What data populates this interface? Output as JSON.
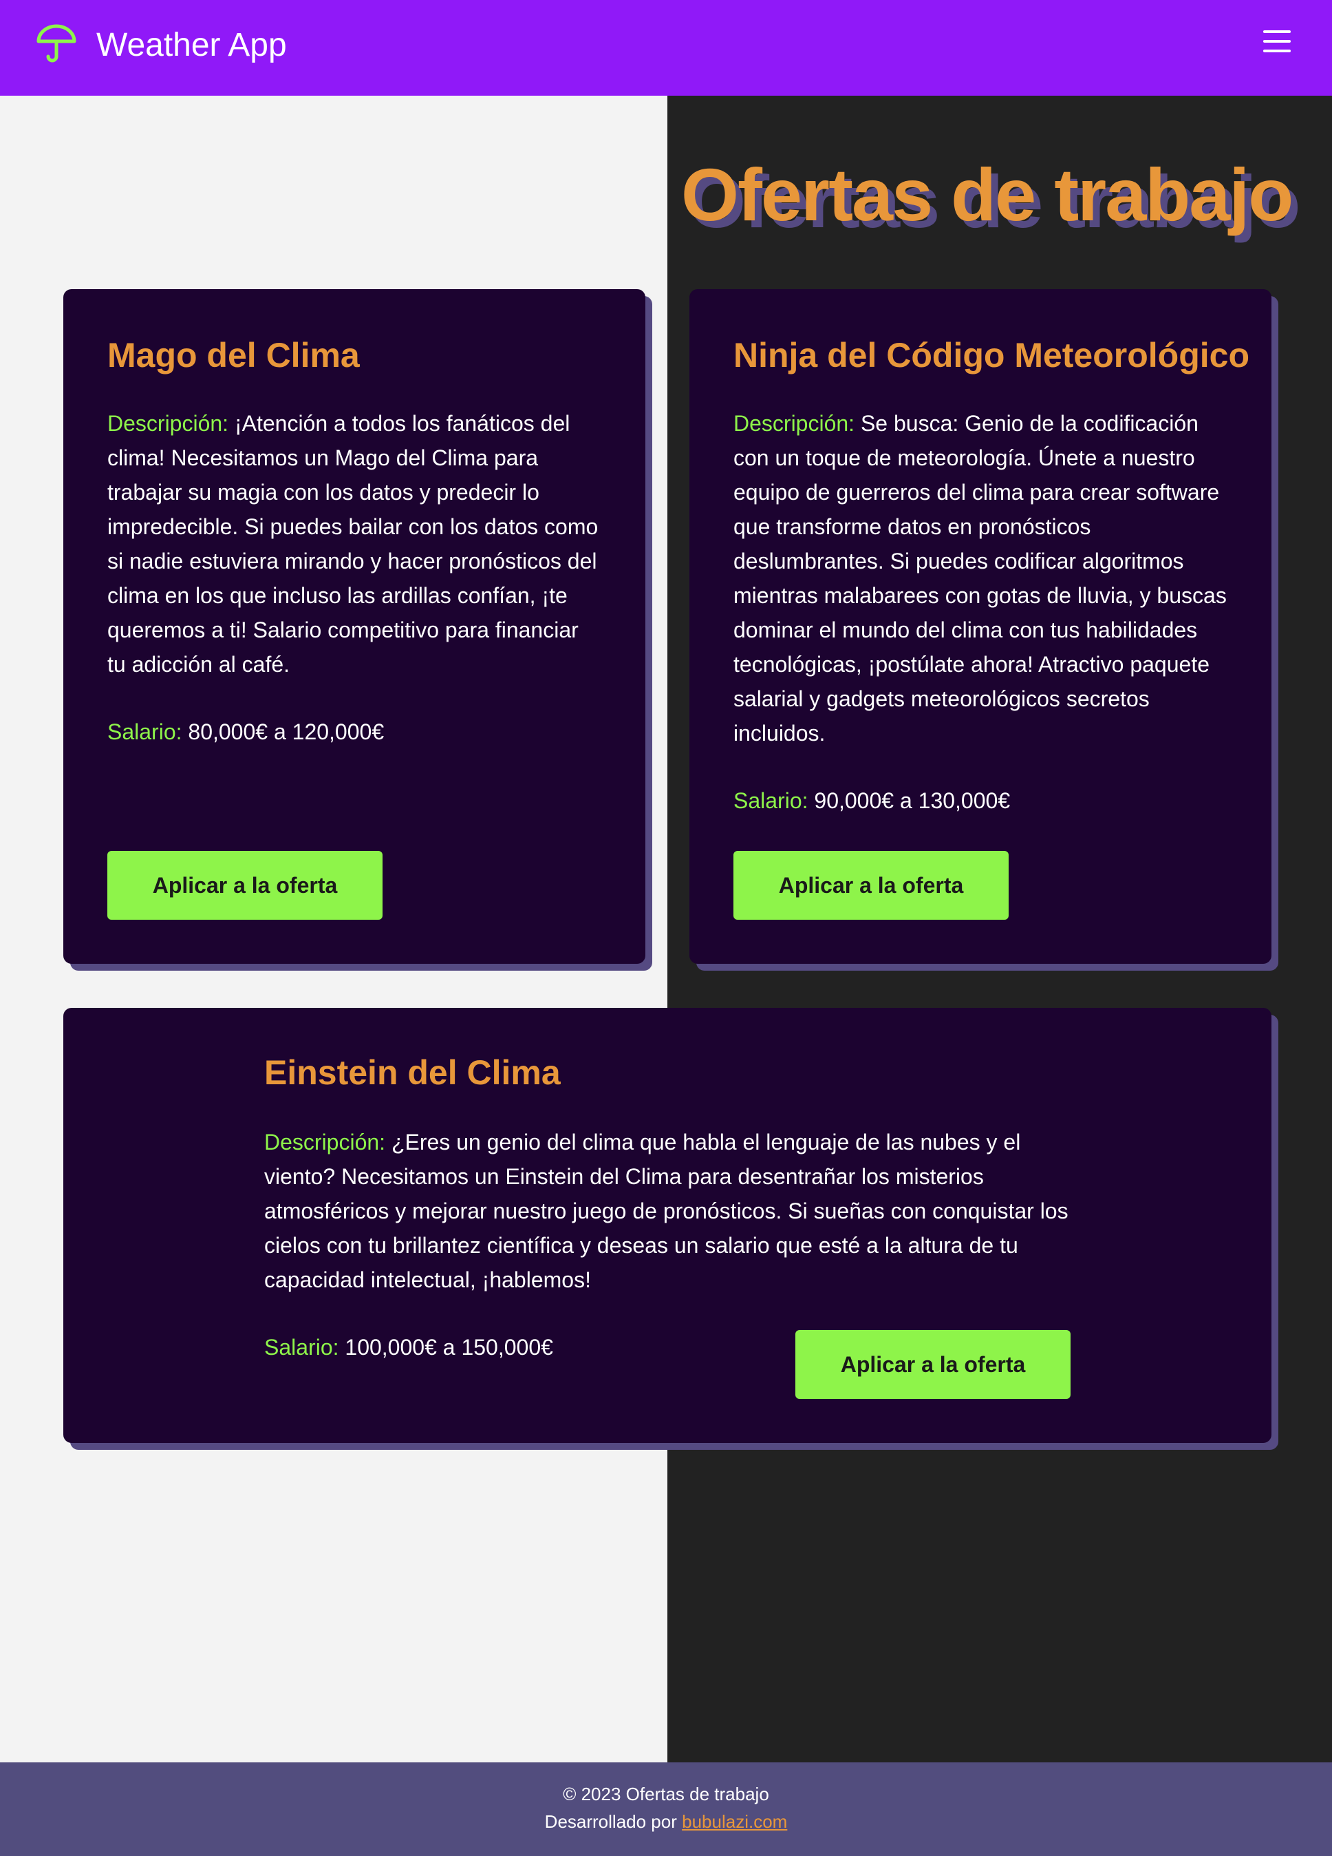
{
  "header": {
    "app_title": "Weather App",
    "logo_icon": "umbrella-icon",
    "menu_icon": "hamburger-menu-icon",
    "background_color": "#9019f8"
  },
  "page": {
    "title": "Ofertas de trabajo"
  },
  "jobs": [
    {
      "title": "Mago del Clima",
      "description_label": "Descripción:",
      "description": "¡Atención a todos los fanáticos del clima! Necesitamos un Mago del Clima para trabajar su magia con los datos y predecir lo impredecible. Si puedes bailar con los datos como si nadie estuviera mirando y hacer pronósticos del clima en los que incluso las ardillas confían, ¡te queremos a ti! Salario competitivo para financiar tu adicción al café.",
      "salary_label": "Salario:",
      "salary": "80,000€ a 120,000€",
      "apply_label": "Aplicar a la oferta"
    },
    {
      "title": "Ninja del Código Meteorológico",
      "description_label": "Descripción:",
      "description": "Se busca: Genio de la codificación con un toque de meteorología. Únete a nuestro equipo de guerreros del clima para crear software que transforme datos en pronósticos deslumbrantes. Si puedes codificar algoritmos mientras malabarees con gotas de lluvia, y buscas dominar el mundo del clima con tus habilidades tecnológicas, ¡postúlate ahora! Atractivo paquete salarial y gadgets meteorológicos secretos incluidos.",
      "salary_label": "Salario:",
      "salary": "90,000€ a 130,000€",
      "apply_label": "Aplicar a la oferta"
    },
    {
      "title": "Einstein del Clima",
      "description_label": "Descripción:",
      "description": "¿Eres un genio del clima que habla el lenguaje de las nubes y el viento? Necesitamos un Einstein del Clima para desentrañar los misterios atmosféricos y mejorar nuestro juego de pronósticos. Si sueñas con conquistar los cielos con tu brillantez científica y deseas un salario que esté a la altura de tu capacidad intelectual, ¡hablemos!",
      "salary_label": "Salario:",
      "salary": "100,000€ a 150,000€",
      "apply_label": "Aplicar a la oferta"
    }
  ],
  "footer": {
    "copyright": "© 2023 Ofertas de trabajo",
    "developed_by": "Desarrollado por",
    "link_text": "bubulazi.com"
  },
  "colors": {
    "accent_orange": "#e8973a",
    "accent_green": "#8ef44a",
    "card_bg": "#1c0330",
    "card_shadow": "#554a82",
    "footer_bg": "#524d7e"
  }
}
